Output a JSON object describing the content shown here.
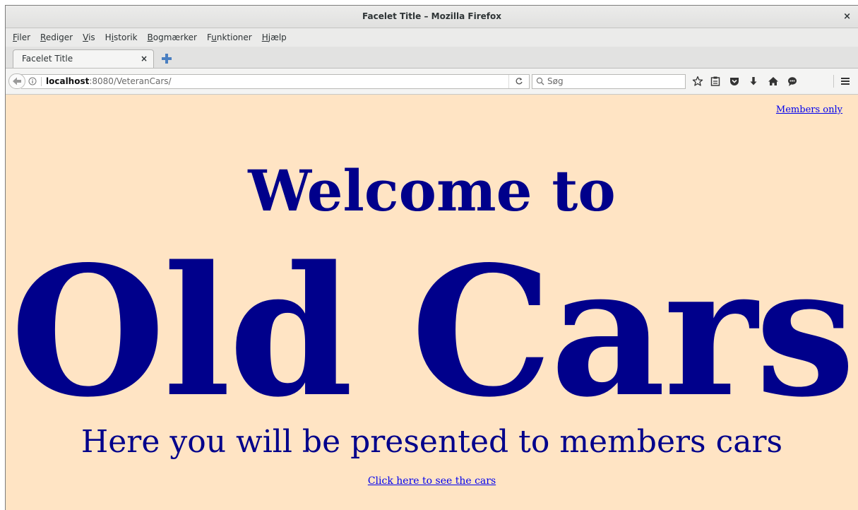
{
  "window": {
    "title": "Facelet Title – Mozilla Firefox",
    "close_glyph": "×"
  },
  "menu": {
    "items": [
      {
        "label_pre": "",
        "label_ul": "F",
        "label_post": "iler"
      },
      {
        "label_pre": "",
        "label_ul": "R",
        "label_post": "ediger"
      },
      {
        "label_pre": "",
        "label_ul": "V",
        "label_post": "is"
      },
      {
        "label_pre": "H",
        "label_ul": "i",
        "label_post": "storik"
      },
      {
        "label_pre": "",
        "label_ul": "B",
        "label_post": "ogmærker"
      },
      {
        "label_pre": "F",
        "label_ul": "u",
        "label_post": "nktioner"
      },
      {
        "label_pre": "",
        "label_ul": "H",
        "label_post": "jælp"
      }
    ]
  },
  "tab": {
    "label": "Facelet Title",
    "close_glyph": "×"
  },
  "navbar": {
    "url_host": "localhost",
    "url_rest": ":8080/VeteranCars/",
    "reload_glyph": "C",
    "search_placeholder": "Søg"
  },
  "page": {
    "members_link": "Members only",
    "heading1": "Welcome to",
    "heading2": "Old Cars",
    "subtitle": "Here you will be presented to members cars",
    "cars_link": "Click here to see the cars"
  },
  "colors": {
    "page_background": "#ffe4c4",
    "heading": "#00008b",
    "link": "#0000ee"
  },
  "icons": [
    "back-arrow-icon",
    "info-icon",
    "reload-icon",
    "search-icon",
    "bookmark-star-icon",
    "reading-list-icon",
    "pocket-icon",
    "download-icon",
    "home-icon",
    "chat-icon",
    "hamburger-menu-icon",
    "new-tab-plus-icon"
  ]
}
